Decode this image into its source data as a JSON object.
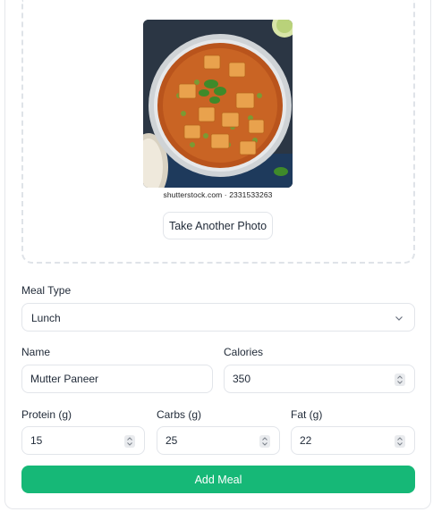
{
  "photo": {
    "watermark": "shutterstock.com · 2331533263",
    "retake_label": "Take Another Photo"
  },
  "meal_type": {
    "label": "Meal Type",
    "selected": "Lunch"
  },
  "name": {
    "label": "Name",
    "value": "Mutter Paneer"
  },
  "calories": {
    "label": "Calories",
    "value": "350"
  },
  "protein": {
    "label": "Protein (g)",
    "value": "15"
  },
  "carbs": {
    "label": "Carbs (g)",
    "value": "25"
  },
  "fat": {
    "label": "Fat (g)",
    "value": "22"
  },
  "submit_label": "Add Meal",
  "colors": {
    "accent": "#16b877",
    "border": "#e2e5ea"
  }
}
